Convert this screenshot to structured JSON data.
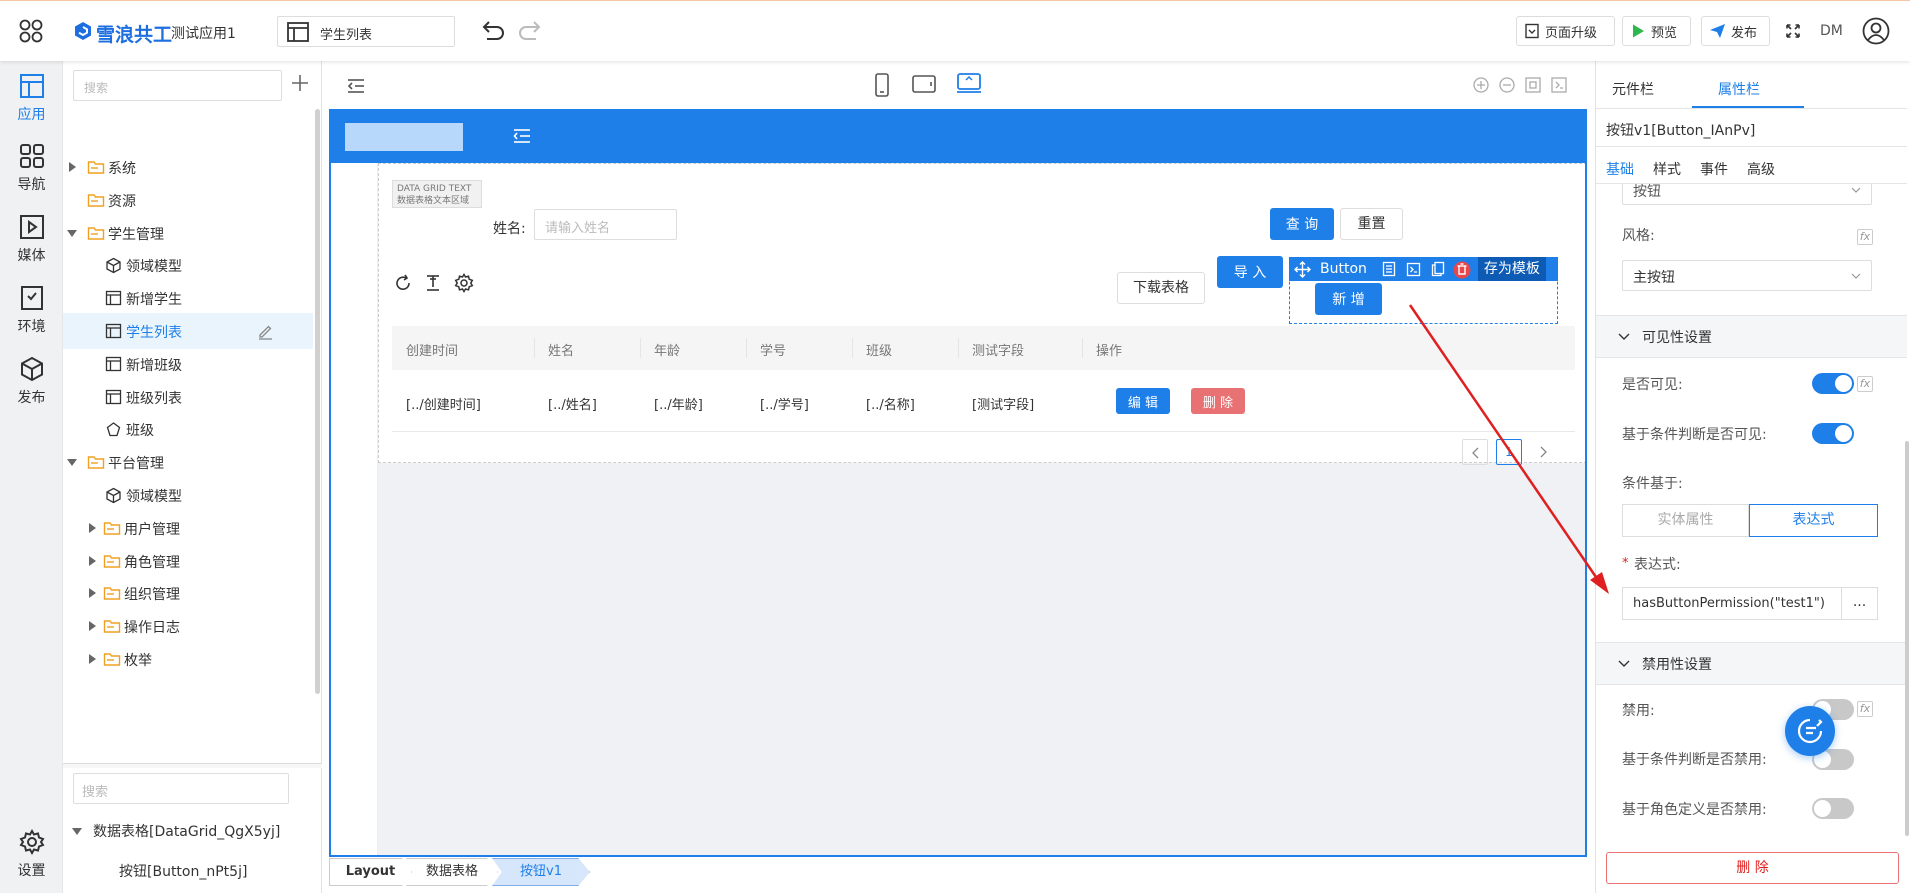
{
  "header": {
    "brand": "雪浪共工",
    "app_name": "测试应用1",
    "page_select": "学生列表",
    "upgrade_label": "页面升级",
    "preview_label": "预览",
    "publish_label": "发布",
    "user_initials": "DM"
  },
  "leftnav": {
    "items": [
      {
        "label": "应用",
        "icon": "layout-icon"
      },
      {
        "label": "导航",
        "icon": "grid-icon"
      },
      {
        "label": "媒体",
        "icon": "media-icon"
      },
      {
        "label": "环境",
        "icon": "environment-icon"
      },
      {
        "label": "发布",
        "icon": "cube-icon"
      }
    ],
    "settings_label": "设置"
  },
  "tree": {
    "search_placeholder": "搜索",
    "nodes": [
      {
        "label": "系统",
        "type": "folder"
      },
      {
        "label": "资源",
        "type": "folder"
      },
      {
        "label": "学生管理",
        "type": "folder"
      },
      {
        "label": "领域模型",
        "type": "model"
      },
      {
        "label": "新增学生",
        "type": "page"
      },
      {
        "label": "学生列表",
        "type": "page"
      },
      {
        "label": "新增班级",
        "type": "page"
      },
      {
        "label": "班级列表",
        "type": "page"
      },
      {
        "label": "班级",
        "type": "flow"
      },
      {
        "label": "平台管理",
        "type": "folder"
      },
      {
        "label": "领域模型",
        "type": "model"
      },
      {
        "label": "用户管理",
        "type": "folder"
      },
      {
        "label": "角色管理",
        "type": "folder"
      },
      {
        "label": "组织管理",
        "type": "folder"
      },
      {
        "label": "操作日志",
        "type": "folder"
      },
      {
        "label": "枚举",
        "type": "folder"
      }
    ],
    "search2_placeholder": "搜索",
    "outline": [
      {
        "label": "数据表格[DataGrid_QgX5yj]"
      },
      {
        "label": "按钮[Button_nPt5j]"
      }
    ]
  },
  "canvas": {
    "datagrid_tag_line1": "DATA GRID TEXT",
    "datagrid_tag_line2": "数据表格文本区域",
    "name_label": "姓名:",
    "name_placeholder": "请输入姓名",
    "query_label": "查 询",
    "reset_label": "重置",
    "download_label": "下载表格",
    "import_label": "导 入",
    "button_toolbar_label": "Button",
    "save_template_label": "存为模板",
    "add_label": "新 增",
    "columns": [
      "创建时间",
      "姓名",
      "年龄",
      "学号",
      "班级",
      "测试字段",
      "操作"
    ],
    "row": [
      "[../创建时间]",
      "[../姓名]",
      "[../年龄]",
      "[../学号]",
      "[../名称]",
      "[测试字段]"
    ],
    "edit_label": "编 辑",
    "delete_label": "删 除",
    "page_number": "1"
  },
  "breadcrumbs": [
    "Layout",
    "数据表格",
    "按钮v1"
  ],
  "props": {
    "tabs": [
      "元件栏",
      "属性栏"
    ],
    "active_tab": "属性栏",
    "component_title": "按钮v1[Button_IAnPv]",
    "subtabs": [
      "基础",
      "样式",
      "事件",
      "高级"
    ],
    "type_value": "按钮",
    "style_label": "风格:",
    "style_value": "主按钮",
    "visibility_section": "可见性设置",
    "visible_label": "是否可见:",
    "cond_visible_label": "基于条件判断是否可见:",
    "cond_based_label": "条件基于:",
    "entity_attr_label": "实体属性",
    "expression_tab_label": "表达式",
    "expression_label": "表达式:",
    "expression_value": "hasButtonPermission(\"test1\")",
    "more_label": "...",
    "disabled_section": "禁用性设置",
    "disabled_label": "禁用:",
    "cond_disabled_label": "基于条件判断是否禁用:",
    "role_disabled_label": "基于角色定义是否禁用:",
    "delete_label": "删 除",
    "fx_label": "fx"
  },
  "colors": {
    "primary": "#1e7fe8",
    "danger": "#e87273",
    "arrow": "#e02020"
  }
}
